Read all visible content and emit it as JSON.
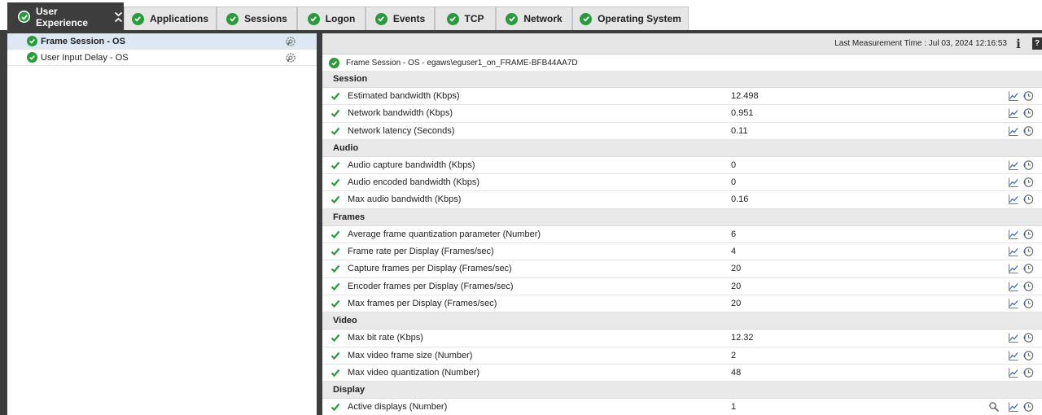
{
  "tabs": [
    {
      "label": "User Experience",
      "active": true
    },
    {
      "label": "Applications"
    },
    {
      "label": "Sessions"
    },
    {
      "label": "Logon"
    },
    {
      "label": "Events"
    },
    {
      "label": "TCP"
    },
    {
      "label": "Network"
    },
    {
      "label": "Operating System"
    }
  ],
  "tests": [
    {
      "label": "Frame Session - OS",
      "selected": true
    },
    {
      "label": "User Input Delay - OS"
    }
  ],
  "last_measurement": "Last Measurement Time : Jul 03, 2024 12:16:53",
  "test_title": "Frame Session - OS - egaws\\eguser1_on_FRAME-BFB44AA7D",
  "groups": [
    {
      "name": "Session",
      "rows": [
        {
          "name": "Estimated bandwidth (Kbps)",
          "value": "12.498"
        },
        {
          "name": "Network bandwidth (Kbps)",
          "value": "0.951"
        },
        {
          "name": "Network latency (Seconds)",
          "value": "0.11"
        }
      ]
    },
    {
      "name": "Audio",
      "rows": [
        {
          "name": "Audio capture bandwidth (Kbps)",
          "value": "0"
        },
        {
          "name": "Audio encoded bandwidth (Kbps)",
          "value": "0"
        },
        {
          "name": "Max audio bandwidth (Kbps)",
          "value": "0.16"
        }
      ]
    },
    {
      "name": "Frames",
      "rows": [
        {
          "name": "Average frame quantization parameter (Number)",
          "value": "6"
        },
        {
          "name": "Frame rate per Display (Frames/sec)",
          "value": "4"
        },
        {
          "name": "Capture frames per Display (Frames/sec)",
          "value": "20"
        },
        {
          "name": "Encoder frames per Display (Frames/sec)",
          "value": "20"
        },
        {
          "name": "Max frames per Display (Frames/sec)",
          "value": "20"
        }
      ]
    },
    {
      "name": "Video",
      "rows": [
        {
          "name": "Max bit rate (Kbps)",
          "value": "12.32"
        },
        {
          "name": "Max video frame size (Number)",
          "value": "2"
        },
        {
          "name": "Max video quantization (Number)",
          "value": "48"
        }
      ]
    },
    {
      "name": "Display",
      "rows": [
        {
          "name": "Active displays (Number)",
          "value": "1",
          "search": true
        }
      ]
    }
  ],
  "colors": {
    "ok_green": "#2a9a3c",
    "frame_dark": "#3d3d3d",
    "selected_bg": "#dde8f4"
  }
}
